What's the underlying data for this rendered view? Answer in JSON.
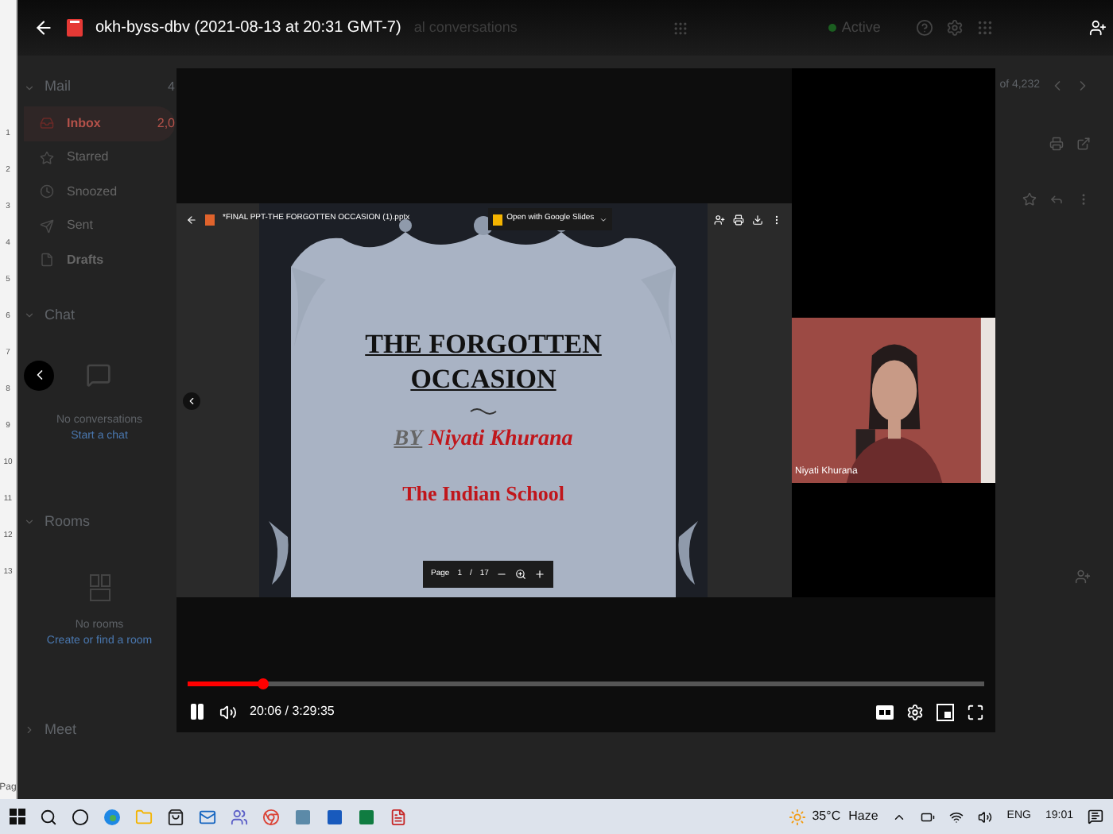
{
  "header": {
    "title": "okh-byss-dbv (2021-08-13 at 20:31 GMT-7)",
    "search_text": "al conversations",
    "status": "Active"
  },
  "ruler": {
    "marks": [
      "1",
      "2",
      "3",
      "4",
      "5",
      "6",
      "7",
      "8",
      "9",
      "10",
      "11",
      "12",
      "13"
    ],
    "footer": "Pag"
  },
  "sidebar": {
    "mail_label": "Mail",
    "mail_count": "4",
    "items": [
      {
        "label": "Inbox",
        "count": "2,0",
        "selected": true,
        "bold": true,
        "kind": "inbox"
      },
      {
        "label": "Starred",
        "selected": false,
        "bold": false,
        "kind": "star"
      },
      {
        "label": "Snoozed",
        "selected": false,
        "bold": false,
        "kind": "clock"
      },
      {
        "label": "Sent",
        "selected": false,
        "bold": false,
        "kind": "send"
      },
      {
        "label": "Drafts",
        "selected": false,
        "bold": true,
        "kind": "file"
      }
    ],
    "chat_label": "Chat",
    "chat_empty": "No conversations",
    "chat_link": "Start a chat",
    "rooms_label": "Rooms",
    "rooms_empty": "No rooms",
    "rooms_link": "Create or find a room",
    "meet_label": "Meet"
  },
  "pager": "of 4,232",
  "player": {
    "share": {
      "file_name": "*FINAL PPT-THE FORGOTTEN OCCASION (1).pptx",
      "open_with": "Open with Google Slides",
      "slide": {
        "title_lines": [
          "THE FORGOTTEN",
          "OCCASION"
        ],
        "by": "BY",
        "author": "Niyati Khurana",
        "school": "The Indian School"
      },
      "page_label": "Page",
      "page": "1",
      "page_sep": "/",
      "page_total": "17"
    },
    "participant": {
      "name": "Niyati Khurana"
    },
    "progress": {
      "level": 0.095
    },
    "playing": true,
    "time": "20:06 / 3:29:35"
  },
  "taskbar": {
    "temperature": "35°C",
    "weather": "Haze",
    "language": "ENG",
    "clock": "19:01"
  }
}
